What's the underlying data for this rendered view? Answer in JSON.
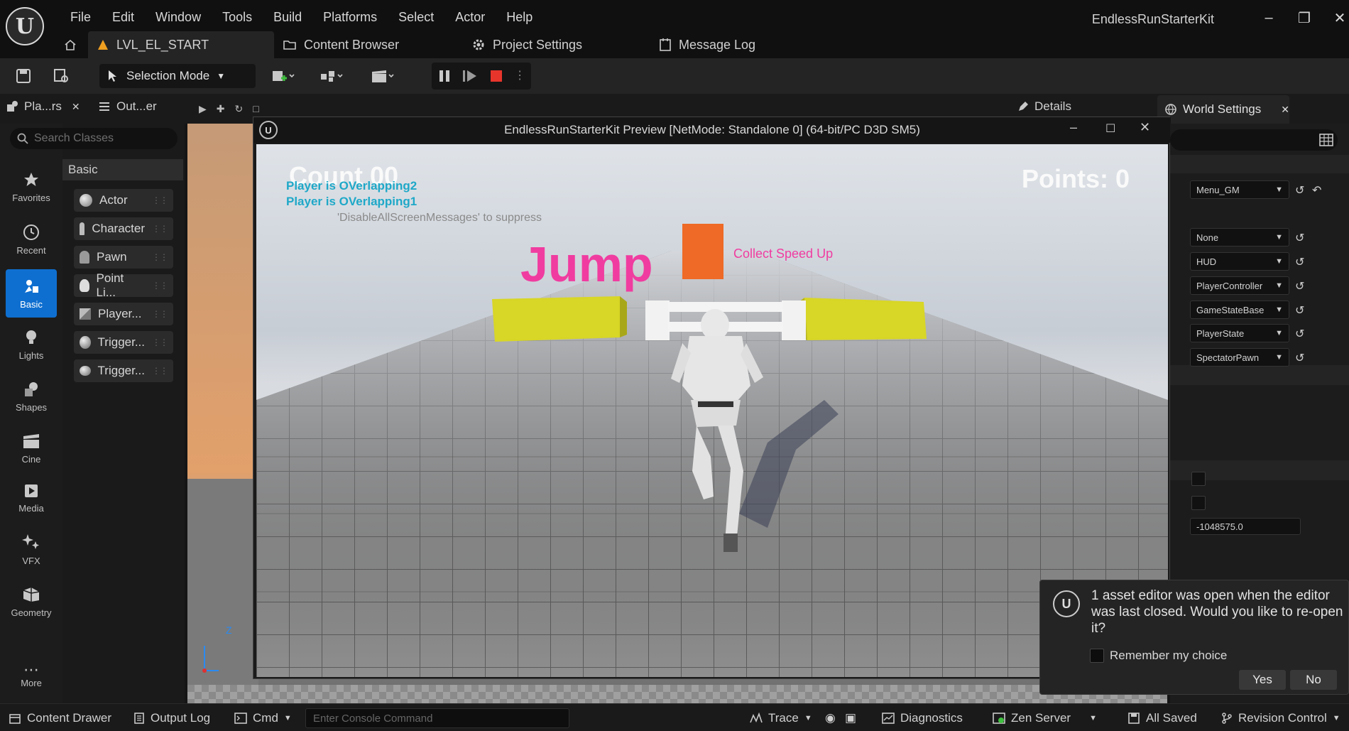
{
  "app": {
    "title": "EndlessRunStarterKit",
    "menu": [
      "File",
      "Edit",
      "Window",
      "Tools",
      "Build",
      "Platforms",
      "Select",
      "Actor",
      "Help"
    ]
  },
  "tabs": [
    {
      "label": "LVL_EL_START"
    },
    {
      "label": "Content Browser"
    },
    {
      "label": "Project Settings"
    },
    {
      "label": "Message Log"
    }
  ],
  "toolbar": {
    "selection_mode": "Selection Mode"
  },
  "panels": {
    "place_actors": "Pla...rs",
    "outliner": "Out...er",
    "details": "Details",
    "world_settings": "World Settings"
  },
  "left_nav": [
    {
      "label": "Favorites",
      "icon": "star-icon"
    },
    {
      "label": "Recent",
      "icon": "clock-icon"
    },
    {
      "label": "Basic",
      "icon": "basic-shapes-icon"
    },
    {
      "label": "Lights",
      "icon": "lightbulb-icon"
    },
    {
      "label": "Shapes",
      "icon": "shapes-icon"
    },
    {
      "label": "Cine",
      "icon": "clapper-icon"
    },
    {
      "label": "Media",
      "icon": "media-icon"
    },
    {
      "label": "VFX",
      "icon": "sparkle-icon"
    },
    {
      "label": "Geometry",
      "icon": "geometry-icon"
    },
    {
      "label": "More",
      "icon": "more-icon"
    }
  ],
  "search": {
    "placeholder": "Search Classes"
  },
  "basic": {
    "header": "Basic",
    "items": [
      "Actor",
      "Character",
      "Pawn",
      "Point Li...",
      "Player...",
      "Trigger...",
      "Trigger..."
    ]
  },
  "pie": {
    "title": "EndlessRunStarterKit Preview [NetMode: Standalone 0]  (64-bit/PC D3D SM5)",
    "hud_count": "Count 00",
    "hud_points": "Points: 0",
    "debug_lines": [
      "Player is OVerlapping2",
      "Player is OVerlapping1"
    ],
    "suppress_msg": "'DisableAllScreenMessages' to suppress",
    "jump_text": "Jump",
    "speed_text": "Collect Speed Up"
  },
  "world_settings": {
    "dropdowns": [
      "Menu_GM",
      "None",
      "HUD",
      "PlayerController",
      "GameStateBase",
      "PlayerState",
      "SpectatorPawn"
    ],
    "kill_z": "-1048575.0"
  },
  "notification": {
    "message": "1 asset editor was open when the editor was last closed. Would you like to re-open it?",
    "checkbox_label": "Remember my choice",
    "yes": "Yes",
    "no": "No"
  },
  "statusbar": {
    "content_drawer": "Content Drawer",
    "output_log": "Output Log",
    "cmd": "Cmd",
    "console_placeholder": "Enter Console Command",
    "trace": "Trace",
    "diagnostics": "Diagnostics",
    "zen_server": "Zen Server",
    "all_saved": "All Saved",
    "revision_control": "Revision Control"
  },
  "colors": {
    "accent": "#0f6fd0",
    "stop": "#e8352c",
    "jump": "#f03ca0",
    "block_yellow": "#d8d626",
    "block_orange": "#ee6a26",
    "debug_cyan": "#1fa8c8"
  }
}
